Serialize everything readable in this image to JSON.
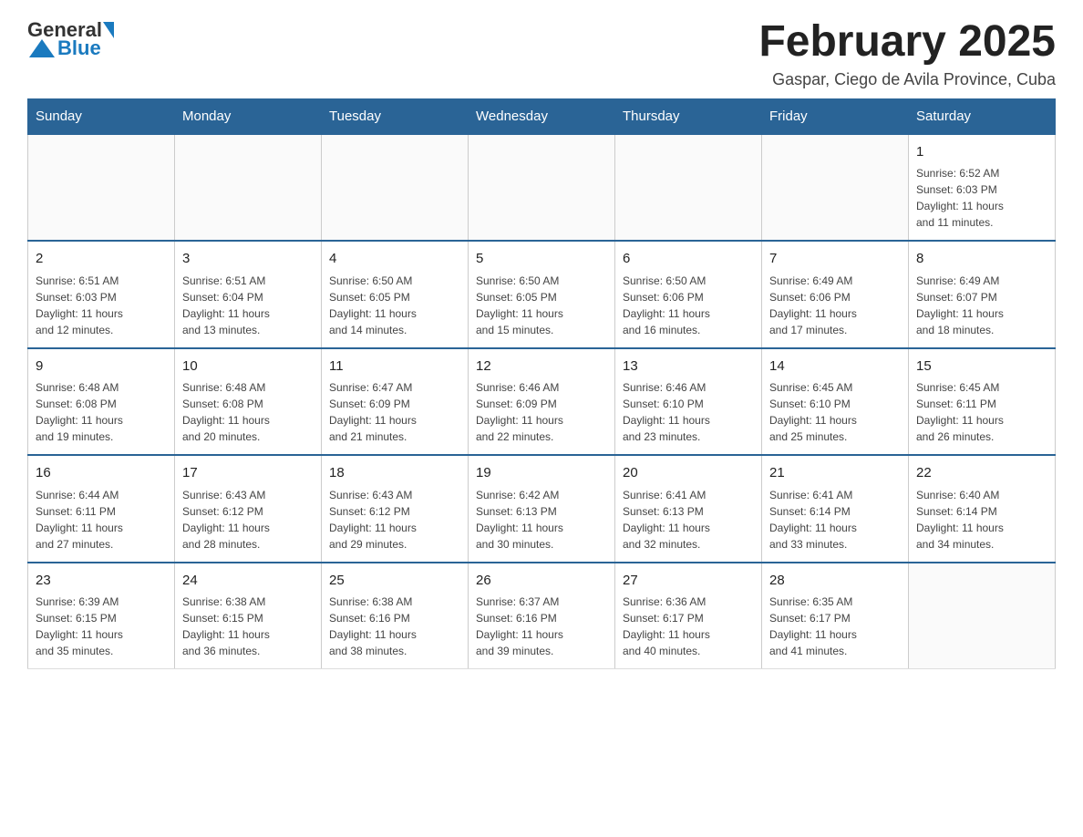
{
  "header": {
    "logo": {
      "general": "General",
      "blue": "Blue"
    },
    "title": "February 2025",
    "subtitle": "Gaspar, Ciego de Avila Province, Cuba"
  },
  "calendar": {
    "weekdays": [
      "Sunday",
      "Monday",
      "Tuesday",
      "Wednesday",
      "Thursday",
      "Friday",
      "Saturday"
    ],
    "weeks": [
      [
        {
          "day": "",
          "info": ""
        },
        {
          "day": "",
          "info": ""
        },
        {
          "day": "",
          "info": ""
        },
        {
          "day": "",
          "info": ""
        },
        {
          "day": "",
          "info": ""
        },
        {
          "day": "",
          "info": ""
        },
        {
          "day": "1",
          "info": "Sunrise: 6:52 AM\nSunset: 6:03 PM\nDaylight: 11 hours\nand 11 minutes."
        }
      ],
      [
        {
          "day": "2",
          "info": "Sunrise: 6:51 AM\nSunset: 6:03 PM\nDaylight: 11 hours\nand 12 minutes."
        },
        {
          "day": "3",
          "info": "Sunrise: 6:51 AM\nSunset: 6:04 PM\nDaylight: 11 hours\nand 13 minutes."
        },
        {
          "day": "4",
          "info": "Sunrise: 6:50 AM\nSunset: 6:05 PM\nDaylight: 11 hours\nand 14 minutes."
        },
        {
          "day": "5",
          "info": "Sunrise: 6:50 AM\nSunset: 6:05 PM\nDaylight: 11 hours\nand 15 minutes."
        },
        {
          "day": "6",
          "info": "Sunrise: 6:50 AM\nSunset: 6:06 PM\nDaylight: 11 hours\nand 16 minutes."
        },
        {
          "day": "7",
          "info": "Sunrise: 6:49 AM\nSunset: 6:06 PM\nDaylight: 11 hours\nand 17 minutes."
        },
        {
          "day": "8",
          "info": "Sunrise: 6:49 AM\nSunset: 6:07 PM\nDaylight: 11 hours\nand 18 minutes."
        }
      ],
      [
        {
          "day": "9",
          "info": "Sunrise: 6:48 AM\nSunset: 6:08 PM\nDaylight: 11 hours\nand 19 minutes."
        },
        {
          "day": "10",
          "info": "Sunrise: 6:48 AM\nSunset: 6:08 PM\nDaylight: 11 hours\nand 20 minutes."
        },
        {
          "day": "11",
          "info": "Sunrise: 6:47 AM\nSunset: 6:09 PM\nDaylight: 11 hours\nand 21 minutes."
        },
        {
          "day": "12",
          "info": "Sunrise: 6:46 AM\nSunset: 6:09 PM\nDaylight: 11 hours\nand 22 minutes."
        },
        {
          "day": "13",
          "info": "Sunrise: 6:46 AM\nSunset: 6:10 PM\nDaylight: 11 hours\nand 23 minutes."
        },
        {
          "day": "14",
          "info": "Sunrise: 6:45 AM\nSunset: 6:10 PM\nDaylight: 11 hours\nand 25 minutes."
        },
        {
          "day": "15",
          "info": "Sunrise: 6:45 AM\nSunset: 6:11 PM\nDaylight: 11 hours\nand 26 minutes."
        }
      ],
      [
        {
          "day": "16",
          "info": "Sunrise: 6:44 AM\nSunset: 6:11 PM\nDaylight: 11 hours\nand 27 minutes."
        },
        {
          "day": "17",
          "info": "Sunrise: 6:43 AM\nSunset: 6:12 PM\nDaylight: 11 hours\nand 28 minutes."
        },
        {
          "day": "18",
          "info": "Sunrise: 6:43 AM\nSunset: 6:12 PM\nDaylight: 11 hours\nand 29 minutes."
        },
        {
          "day": "19",
          "info": "Sunrise: 6:42 AM\nSunset: 6:13 PM\nDaylight: 11 hours\nand 30 minutes."
        },
        {
          "day": "20",
          "info": "Sunrise: 6:41 AM\nSunset: 6:13 PM\nDaylight: 11 hours\nand 32 minutes."
        },
        {
          "day": "21",
          "info": "Sunrise: 6:41 AM\nSunset: 6:14 PM\nDaylight: 11 hours\nand 33 minutes."
        },
        {
          "day": "22",
          "info": "Sunrise: 6:40 AM\nSunset: 6:14 PM\nDaylight: 11 hours\nand 34 minutes."
        }
      ],
      [
        {
          "day": "23",
          "info": "Sunrise: 6:39 AM\nSunset: 6:15 PM\nDaylight: 11 hours\nand 35 minutes."
        },
        {
          "day": "24",
          "info": "Sunrise: 6:38 AM\nSunset: 6:15 PM\nDaylight: 11 hours\nand 36 minutes."
        },
        {
          "day": "25",
          "info": "Sunrise: 6:38 AM\nSunset: 6:16 PM\nDaylight: 11 hours\nand 38 minutes."
        },
        {
          "day": "26",
          "info": "Sunrise: 6:37 AM\nSunset: 6:16 PM\nDaylight: 11 hours\nand 39 minutes."
        },
        {
          "day": "27",
          "info": "Sunrise: 6:36 AM\nSunset: 6:17 PM\nDaylight: 11 hours\nand 40 minutes."
        },
        {
          "day": "28",
          "info": "Sunrise: 6:35 AM\nSunset: 6:17 PM\nDaylight: 11 hours\nand 41 minutes."
        },
        {
          "day": "",
          "info": ""
        }
      ]
    ]
  }
}
